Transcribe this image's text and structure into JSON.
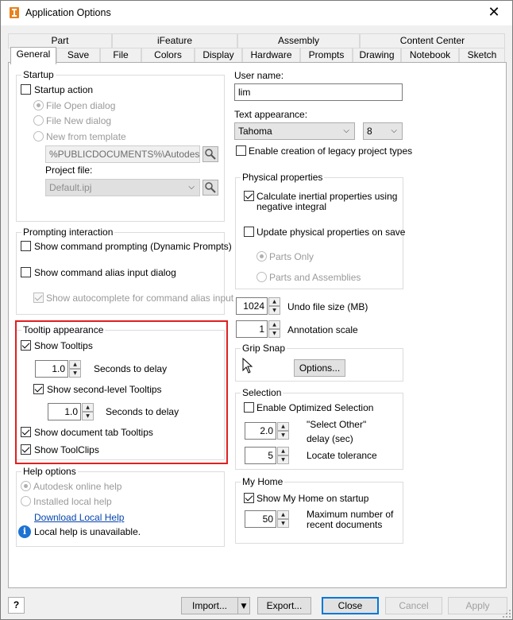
{
  "window": {
    "title": "Application Options",
    "close_glyph": "✕"
  },
  "tabs_row1": [
    "Part",
    "iFeature",
    "Assembly",
    "Content Center"
  ],
  "tabs_row2": [
    "General",
    "Save",
    "File",
    "Colors",
    "Display",
    "Hardware",
    "Prompts",
    "Drawing",
    "Notebook",
    "Sketch"
  ],
  "startup": {
    "group_label": "Startup",
    "startup_action_label": "Startup action",
    "startup_action_checked": false,
    "radio_file_open": "File Open dialog",
    "radio_file_new": "File New dialog",
    "radio_new_template": "New from template",
    "selected_radio": "File Open dialog",
    "template_path": "%PUBLICDOCUMENTS%\\Autodesk\\Inv",
    "project_file_label": "Project file:",
    "project_file_value": "Default.ipj"
  },
  "prompting": {
    "group_label": "Prompting interaction",
    "show_command_prompting": "Show command prompting (Dynamic Prompts)",
    "show_command_prompting_checked": false,
    "show_alias_dialog": "Show command alias input dialog",
    "show_alias_dialog_checked": false,
    "show_autocomplete": "Show autocomplete for command alias input",
    "show_autocomplete_checked": true
  },
  "tooltip": {
    "group_label": "Tooltip appearance",
    "show_tooltips": "Show Tooltips",
    "show_tooltips_checked": true,
    "delay1_value": "1.0",
    "delay1_label": "Seconds to delay",
    "show_second_level": "Show second-level Tooltips",
    "show_second_level_checked": true,
    "delay2_value": "1.0",
    "delay2_label": "Seconds to delay",
    "show_doc_tab": "Show document tab Tooltips",
    "show_doc_tab_checked": true,
    "show_toolclips": "Show ToolClips",
    "show_toolclips_checked": true
  },
  "help": {
    "group_label": "Help options",
    "radio_online": "Autodesk online help",
    "radio_local": "Installed local help",
    "selected_radio": "Autodesk online help",
    "download_link": "Download Local Help",
    "info_text": "Local help is unavailable.",
    "info_glyph": "i"
  },
  "user": {
    "user_name_label": "User name:",
    "user_name_value": "lim",
    "text_appearance_label": "Text appearance:",
    "font_value": "Tahoma",
    "size_value": "8",
    "legacy_label": "Enable creation of legacy project types",
    "legacy_checked": false
  },
  "physical": {
    "group_label": "Physical properties",
    "calc_inertial_line1": "Calculate inertial properties using",
    "calc_inertial_line2": "negative integral",
    "calc_inertial_checked": true,
    "update_on_save": "Update physical properties on save",
    "update_on_save_checked": false,
    "radio_parts_only": "Parts Only",
    "radio_parts_assemblies": "Parts and Assemblies",
    "selected_radio": "Parts Only"
  },
  "undo": {
    "value": "1024",
    "label": "Undo file size (MB)"
  },
  "annotation": {
    "value": "1",
    "label": "Annotation scale"
  },
  "grip_snap": {
    "group_label": "Grip Snap",
    "options_button": "Options..."
  },
  "selection": {
    "group_label": "Selection",
    "enable_optimized": "Enable Optimized Selection",
    "enable_optimized_checked": false,
    "select_other_value": "2.0",
    "select_other_line1": "\"Select Other\"",
    "select_other_line2": "delay (sec)",
    "locate_value": "5",
    "locate_label": "Locate tolerance"
  },
  "my_home": {
    "group_label": "My Home",
    "show_my_home": "Show My Home on startup",
    "show_my_home_checked": true,
    "max_docs_value": "50",
    "max_docs_line1": "Maximum number of",
    "max_docs_line2": "recent documents"
  },
  "footer": {
    "help_glyph": "?",
    "import_button": "Import...",
    "export_button": "Export...",
    "close_button": "Close",
    "cancel_button": "Cancel",
    "apply_button": "Apply"
  },
  "colors": {
    "accent": "#0078d7",
    "highlight_box": "#e0201f",
    "link": "#0645ad",
    "app_icon": "#e8821e"
  }
}
